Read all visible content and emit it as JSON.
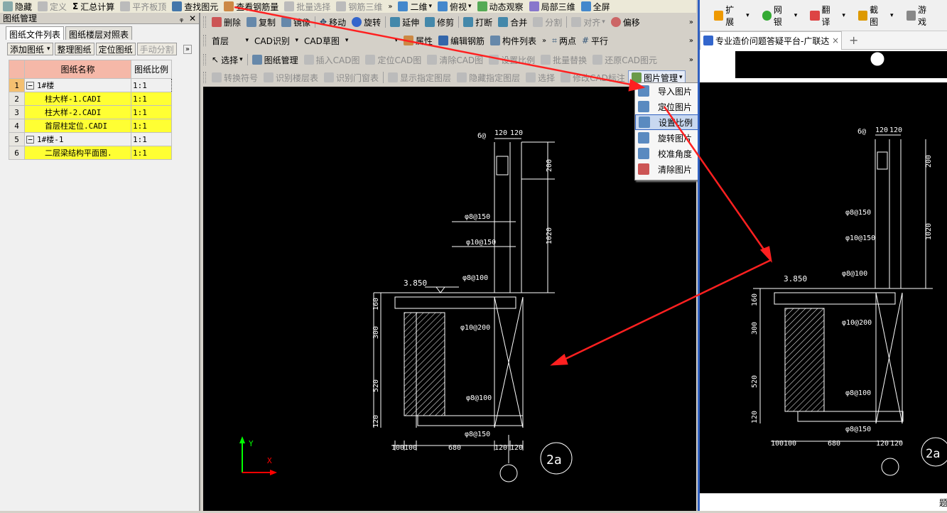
{
  "toolbar1": {
    "hide": "隐藏",
    "define": "定义",
    "summary": "汇总计算",
    "flat": "平齐板顶",
    "find": "查找图元",
    "view_rebar": "查看钢筋量",
    "batch_select": "批量选择",
    "rebar3d": "钢筋三维",
    "mode2d": "二维",
    "top_view": "俯视",
    "dynamic": "动态观察",
    "local3d": "局部三维",
    "full": "全屏"
  },
  "toolbar2": {
    "delete": "删除",
    "copy": "复制",
    "mirror": "镜像",
    "move": "移动",
    "rotate": "旋转",
    "extend": "延伸",
    "trim": "修剪",
    "break": "打断",
    "merge": "合并",
    "split": "分割",
    "align": "对齐",
    "offset": "偏移"
  },
  "toolbar3": {
    "floor": "首层",
    "cad_recog": "CAD识别",
    "cad_draft": "CAD草图",
    "props": "属性",
    "edit_rebar": "编辑钢筋",
    "comp_list": "构件列表",
    "two_point": "两点",
    "parallel": "平行"
  },
  "toolbar4": {
    "select": "选择",
    "drawing_mgmt": "图纸管理",
    "insert_cad": "插入CAD图",
    "locate_cad": "定位CAD图",
    "clear_cad": "清除CAD图",
    "set_scale": "设置比例",
    "batch_replace": "批量替换",
    "restore_cad": "还原CAD图元"
  },
  "toolbar5": {
    "convert": "转换符号",
    "recog_floor": "识别楼层表",
    "recog_door": "识别门窗表",
    "show_layer": "显示指定图层",
    "hide_layer": "隐藏指定图层",
    "select_short": "选择",
    "modify_cad": "修改CAD标注",
    "image_mgmt": "图片管理"
  },
  "panel": {
    "title": "图纸管理",
    "pin": "ᵩ",
    "close": "✕",
    "tab1": "图纸文件列表",
    "tab2": "图纸楼层对照表",
    "add": "添加图纸",
    "organize": "整理图纸",
    "locate": "定位图纸",
    "manual_split": "手动分割",
    "col_name": "图纸名称",
    "col_scale": "图纸比例",
    "rows": [
      {
        "n": "1",
        "name": "1#楼",
        "scale": "1:1",
        "exp": "−"
      },
      {
        "n": "2",
        "name": "柱大样-1.CADI",
        "scale": "1:1"
      },
      {
        "n": "3",
        "name": "柱大样-2.CADI",
        "scale": "1:1"
      },
      {
        "n": "4",
        "name": "首层柱定位.CADI",
        "scale": "1:1"
      },
      {
        "n": "5",
        "name": "1#楼-1",
        "scale": "1:1",
        "exp": "−"
      },
      {
        "n": "6",
        "name": "二层梁结构平面图.",
        "scale": "1:1"
      }
    ]
  },
  "menu": {
    "items": [
      "导入图片",
      "定位图片",
      "设置比例",
      "旋转图片",
      "校准角度",
      "清除图片"
    ]
  },
  "cad": {
    "d1": "6@",
    "d2": "120",
    "d3": "120",
    "dim200": "200",
    "dim1020": "1020",
    "r1": "φ8@150",
    "r2": "φ10@150",
    "r3": "φ8@100",
    "elev": "3.850",
    "v160": "160",
    "v300": "300",
    "v520": "520",
    "v120": "120",
    "r4": "φ10@200",
    "r5": "φ8@100",
    "r6": "φ8@150",
    "b100a": "100",
    "b100b": "100",
    "b680": "680",
    "b120a": "120",
    "b120b": "120",
    "label": "2a",
    "ax_y": "Y",
    "ax_x": "X"
  },
  "browser": {
    "ext": "扩展",
    "bank": "网银",
    "translate": "翻译",
    "shot": "截图",
    "game": "游戏",
    "tab_title": "专业造价问题答疑平台-广联达",
    "new_tab": "+",
    "tab_close": "×",
    "side_char": "题"
  }
}
